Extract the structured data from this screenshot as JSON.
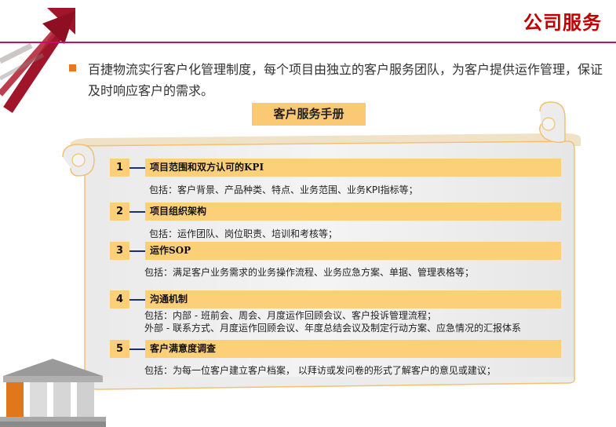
{
  "header": {
    "title": "公司服务"
  },
  "intro": {
    "text": "百捷物流实行客户化管理制度，每个项目由独立的客户服务团队，为客户提供运作管理，保证及时响应客户的需求。"
  },
  "manual": {
    "title": "客户服务手册"
  },
  "items": [
    {
      "num": "1",
      "title": "项目范围和双方认可的KPI",
      "desc": [
        "包括：客户背景、产品种类、特点、业务范围、业务KPI指标等；"
      ]
    },
    {
      "num": "2",
      "title": "项目组织架构",
      "desc": [
        "包括：运作团队、岗位职责、培训和考核等；"
      ]
    },
    {
      "num": "3",
      "title": "运作SOP",
      "desc": [
        "包括：满足客户业务需求的业务操作流程、业务应急方案、单据、管理表格等；"
      ]
    },
    {
      "num": "4",
      "title": "沟通机制",
      "desc": [
        "包括：内部 - 班前会、周会、月度运作回顾会议、客户投诉管理流程；",
        "外部 - 联系方式、月度运作回顾会议、年度总结会议及制定行动方案、应急情况的汇报体系"
      ]
    },
    {
      "num": "5",
      "title": "客户满意度调查",
      "desc": [
        "包括：为每一位客户建立客户档案， 以拜访或发问卷的形式了解客户的意见或建议；"
      ]
    }
  ],
  "colors": {
    "accent": "#c00000",
    "bar": "#fcd079",
    "connector": "#1f2f73",
    "bullet": "#e87722",
    "line": "#c40f6a"
  }
}
